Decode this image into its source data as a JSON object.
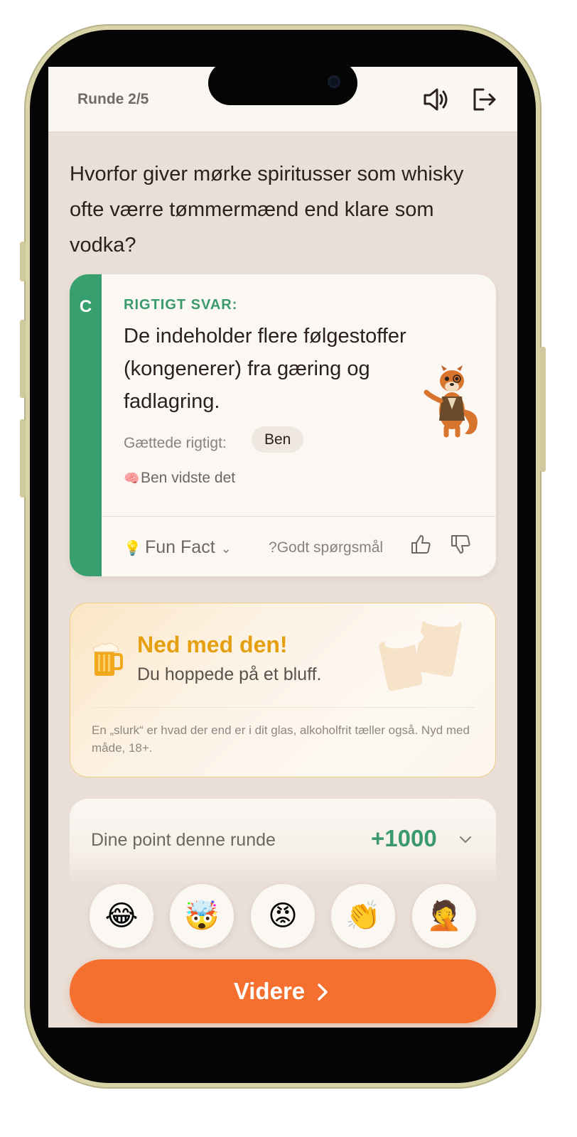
{
  "header": {
    "round_label": "Runde 2/5",
    "sound_icon": "speaker-icon",
    "exit_icon": "exit-icon"
  },
  "question": {
    "text": "Hvorfor giver mørke spiritusser som whisky ofte værre tømmermænd end klare som vodka?"
  },
  "answer_card": {
    "letter": "C",
    "correct_label": "RIGTIGT SVAR:",
    "answer_text": "De indeholder flere følgestoffer (kongenerer) fra gæring og fadlagring.",
    "guessed_label": "Gættede rigtigt:",
    "guessed_player": "Ben",
    "knew_text": "Ben vidste det",
    "fun_fact_label": "Fun Fact",
    "good_question_label": "Godt spørgsmål?",
    "stripe_color": "#38a06f"
  },
  "drink_card": {
    "title": "Ned med den!",
    "subtitle": "Du hoppede på et bluff.",
    "note": "En „slurk“ er hvad der end er i dit glas, alkoholfrit tæller også. Nyd med måde, 18+."
  },
  "points": {
    "label": "Dine point denne runde",
    "value": "+1000"
  },
  "reactions": [
    {
      "emoji": "😂",
      "name": "laughing-emoji"
    },
    {
      "emoji": "🤯",
      "name": "mind-blown-emoji"
    },
    {
      "emoji": "😡",
      "name": "angry-emoji"
    },
    {
      "emoji": "👏",
      "name": "clapping-emoji"
    },
    {
      "emoji": "🤦",
      "name": "facepalm-emoji"
    }
  ],
  "next_button": {
    "label": "Videre"
  },
  "colors": {
    "accent_orange": "#f56f2f",
    "correct_green": "#38a06f",
    "drink_yellow": "#e4a010",
    "screen_bg": "#e9dfd7"
  }
}
